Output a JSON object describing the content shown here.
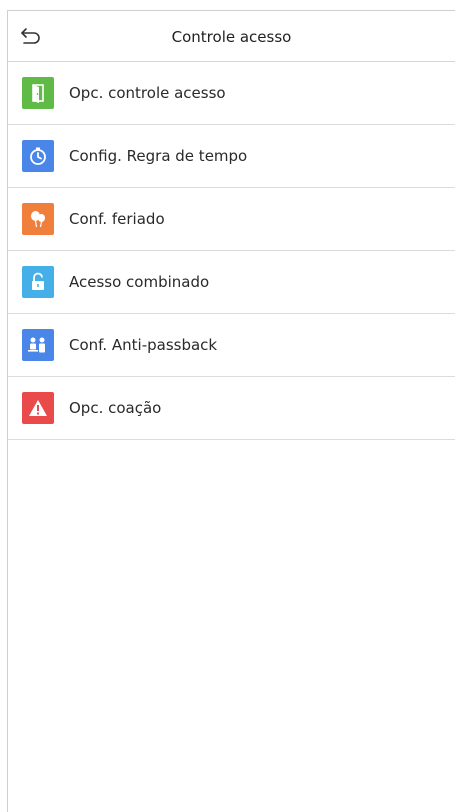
{
  "header": {
    "title": "Controle acesso",
    "back_icon": "undo-arrow-icon"
  },
  "menu": {
    "items": [
      {
        "label": "Opc. controle acesso",
        "icon": "door-icon",
        "color": "#5fba46"
      },
      {
        "label": "Config. Regra de tempo",
        "icon": "clock-icon",
        "color": "#4a86e8"
      },
      {
        "label": "Conf. feriado",
        "icon": "balloons-icon",
        "color": "#f07f3c"
      },
      {
        "label": "Acesso combinado",
        "icon": "unlock-icon",
        "color": "#45b0e8"
      },
      {
        "label": "Conf. Anti-passback",
        "icon": "people-icon",
        "color": "#4a86e8"
      },
      {
        "label": "Opc. coação",
        "icon": "warning-icon",
        "color": "#e94b4b"
      }
    ]
  }
}
